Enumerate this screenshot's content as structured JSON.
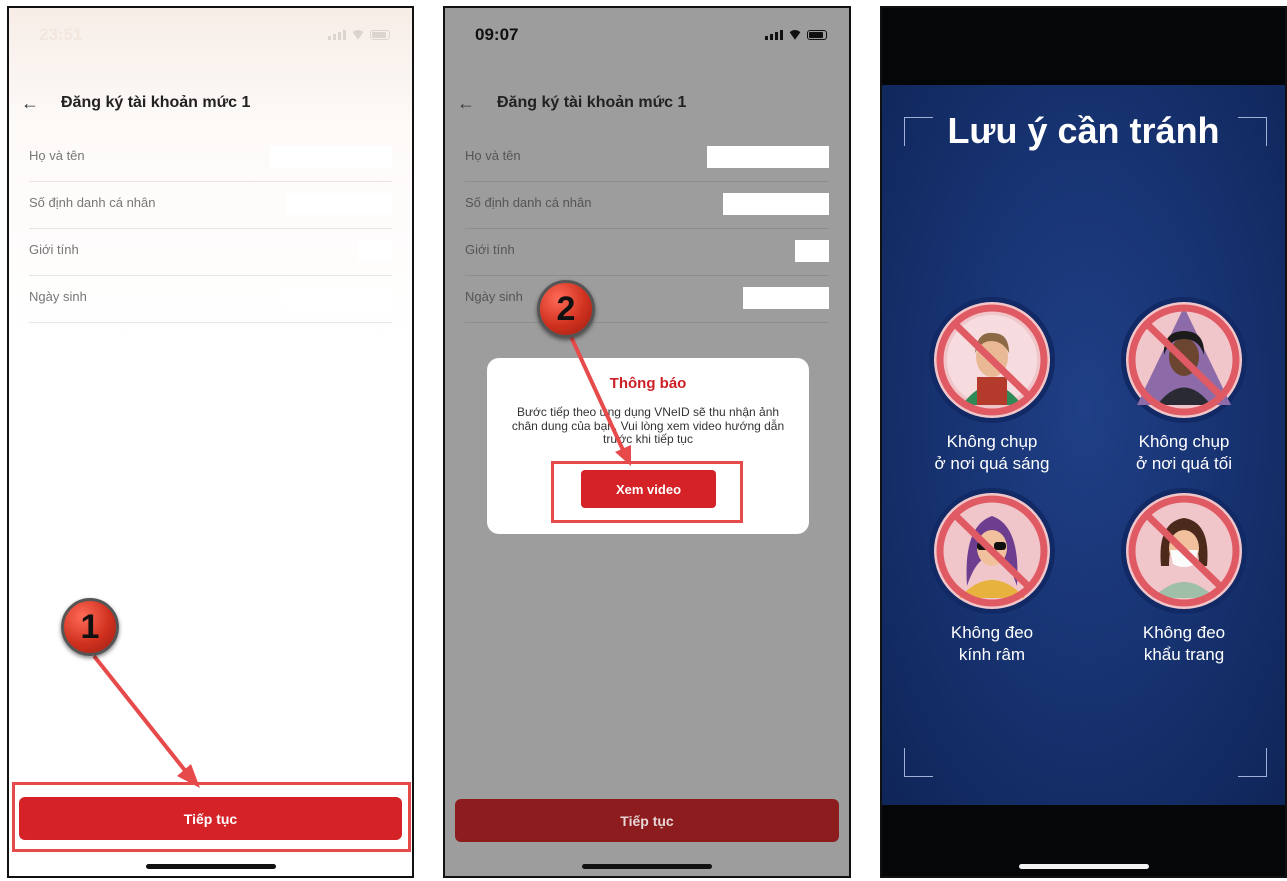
{
  "screen1": {
    "status_time": "23:51",
    "header_title": "Đăng ký tài khoản mức 1",
    "fields": [
      {
        "label": "Họ và tên"
      },
      {
        "label": "Số định danh cá nhân"
      },
      {
        "label": "Giới tính"
      },
      {
        "label": "Ngày sinh"
      }
    ],
    "continue_label": "Tiếp tục",
    "step_badge": "1"
  },
  "screen2": {
    "status_time": "09:07",
    "header_title": "Đăng ký tài khoản mức 1",
    "fields": [
      {
        "label": "Họ và tên"
      },
      {
        "label": "Số định danh cá nhân"
      },
      {
        "label": "Giới tính"
      },
      {
        "label": "Ngày sinh"
      }
    ],
    "dialog": {
      "title": "Thông báo",
      "message": "Bước tiếp theo ứng dụng VNeID sẽ thu nhận ảnh chân dung của bạn. Vui lòng xem video hướng dẫn trước khi tiếp tục",
      "button_label": "Xem video"
    },
    "continue_label": "Tiếp tục",
    "step_badge": "2"
  },
  "screen3": {
    "title": "Lưu ý cần tránh",
    "items": [
      {
        "caption_line1": "Không chụp",
        "caption_line2": "ở nơi quá sáng"
      },
      {
        "caption_line1": "Không chụp",
        "caption_line2": "ở nơi quá tối"
      },
      {
        "caption_line1": "Không đeo",
        "caption_line2": "kính râm"
      },
      {
        "caption_line1": "Không đeo",
        "caption_line2": "khẩu trang"
      }
    ]
  },
  "colors": {
    "brand_red": "#d42227",
    "annotation_red": "#e74a4a",
    "poster_blue": "#16316e"
  }
}
